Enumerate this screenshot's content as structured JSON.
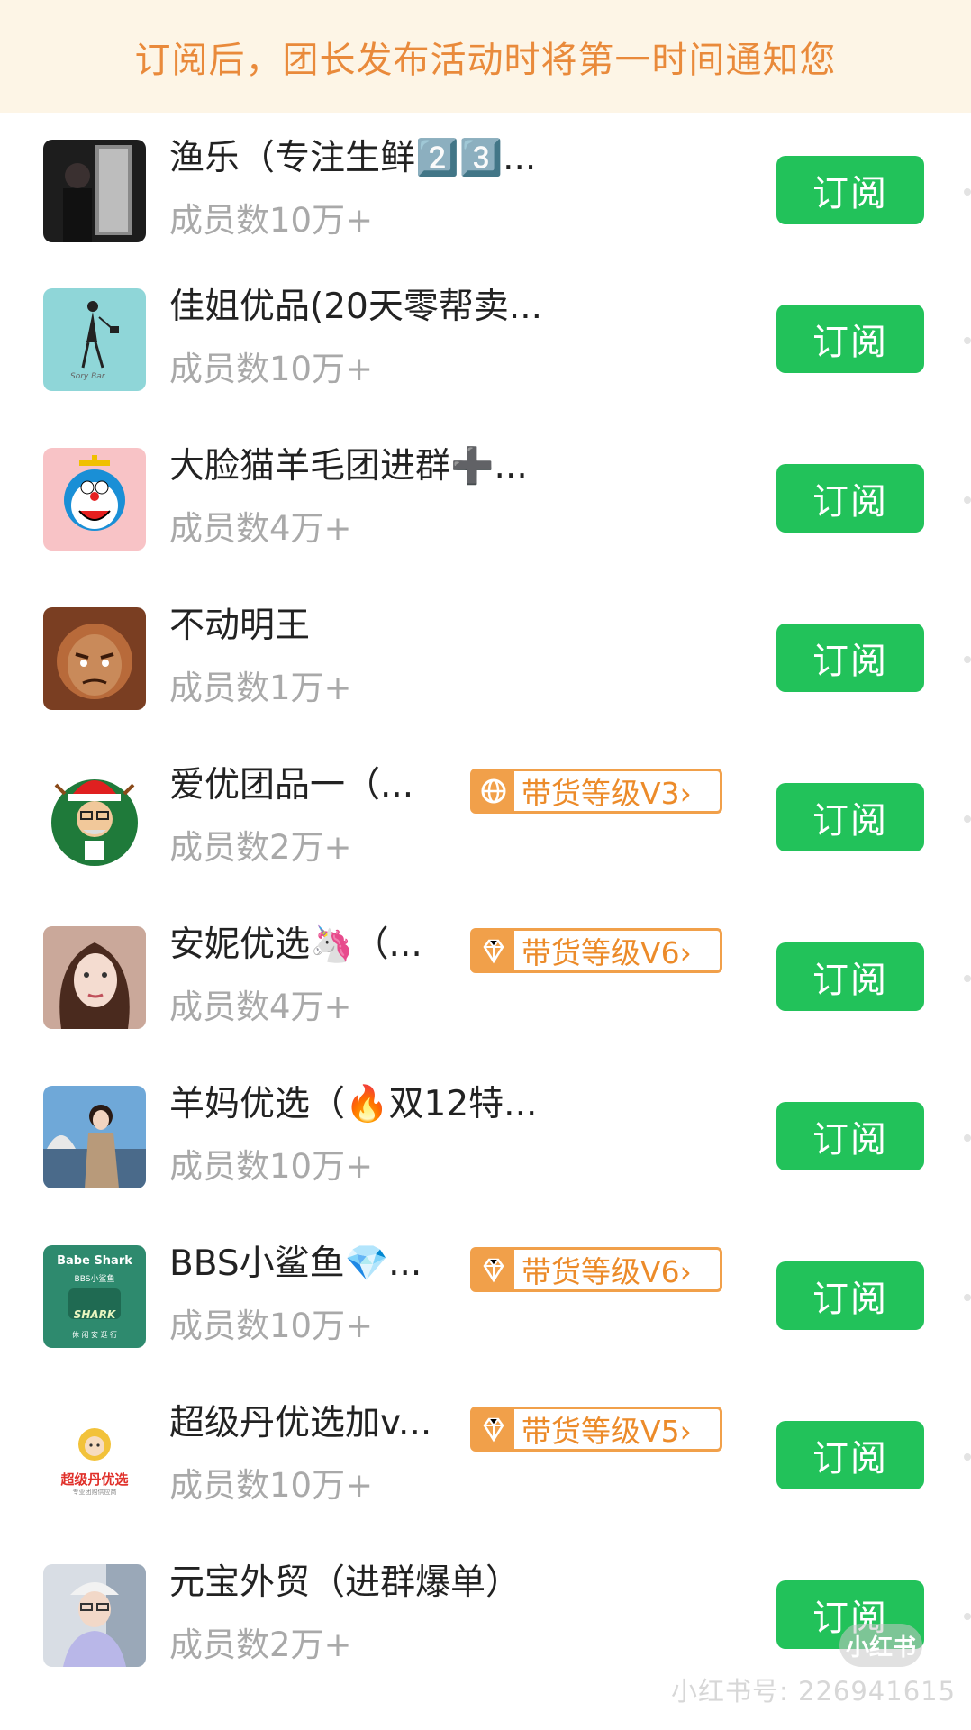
{
  "banner": {
    "text": "订阅后，团长发布活动时将第一时间通知您"
  },
  "groups": [
    {
      "name": "渔乐（专注生鲜2️⃣3️⃣...",
      "members": "成员数10万+",
      "button": "订阅"
    },
    {
      "name": "佳姐优品(20天零帮卖...",
      "members": "成员数10万+",
      "button": "订阅"
    },
    {
      "name": "大脸猫羊毛团进群➕...",
      "members": "成员数4万+",
      "button": "订阅"
    },
    {
      "name": "不动明王",
      "members": "成员数1万+",
      "button": "订阅"
    },
    {
      "name": "爱优团品一（...",
      "members": "成员数2万+",
      "button": "订阅",
      "badge": "带货等级V3›"
    },
    {
      "name": "安妮优选🦄（...",
      "members": "成员数4万+",
      "button": "订阅",
      "badge": "带货等级V6›"
    },
    {
      "name": "羊妈优选（🔥双12特...",
      "members": "成员数10万+",
      "button": "订阅"
    },
    {
      "name": "BBS小鲨鱼💎...",
      "members": "成员数10万+",
      "button": "订阅",
      "badge": "带货等级V6›"
    },
    {
      "name": "超级丹优选加v...",
      "members": "成员数10万+",
      "button": "订阅",
      "badge": "带货等级V5›"
    },
    {
      "name": "元宝外贸（进群爆单）",
      "members": "成员数2万+",
      "button": "订阅"
    }
  ],
  "avatar_texts": {
    "bbs_title": "Babe Shark",
    "bbs_sub": "BBS小鲨鱼",
    "bbs_logo": "SHARK",
    "bbs_bottom": "休 闲 安 逛 行",
    "dan_title": "超级丹优选",
    "dan_sub": "专业团购供应商"
  },
  "watermark": {
    "text": "小红书号: 226941615",
    "logo": "小红书"
  },
  "colors": {
    "accent_green": "#22c25a",
    "badge_orange": "#f1a04a",
    "banner_bg": "#fdf5e6",
    "banner_text": "#e98a3b"
  }
}
